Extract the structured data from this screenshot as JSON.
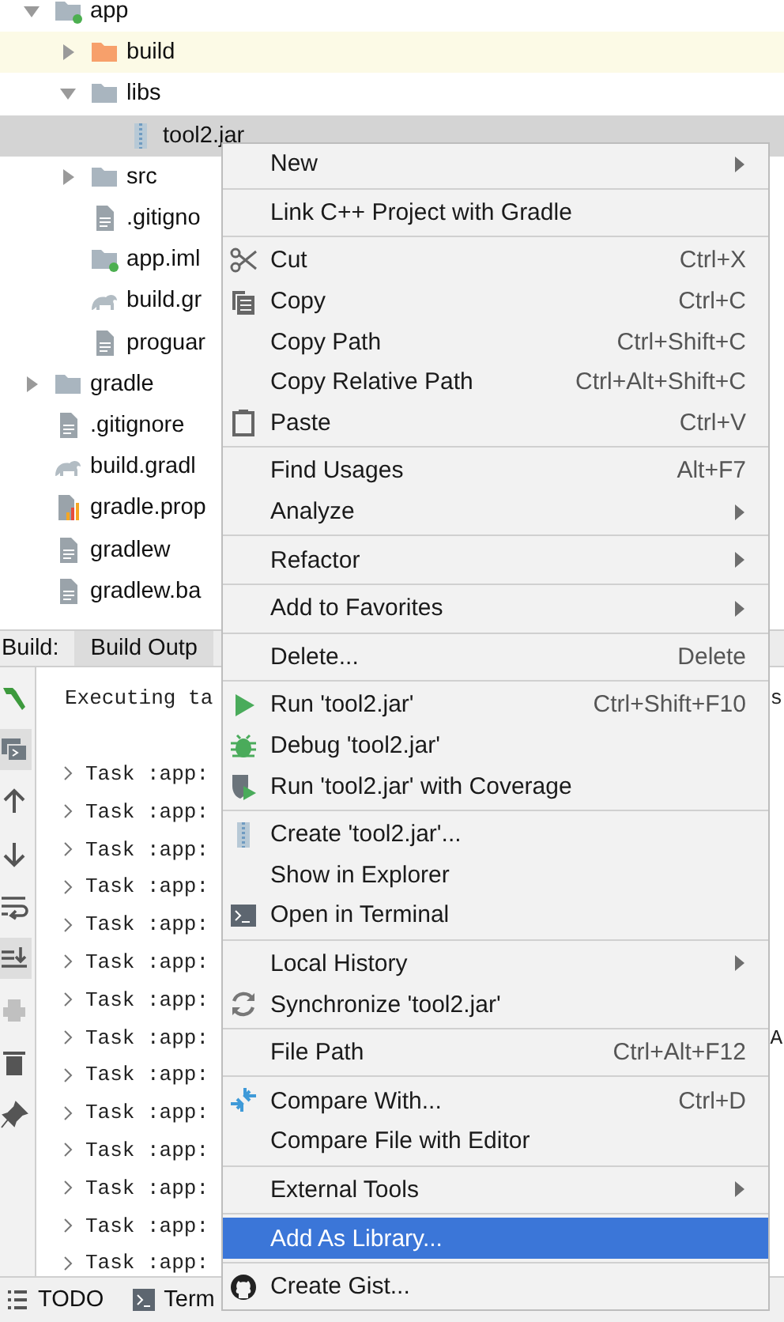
{
  "tree": [
    {
      "label": "app",
      "kind": "module",
      "expanded": true,
      "selected": false,
      "children": [
        {
          "label": "build",
          "kind": "excluded",
          "expanded": false,
          "selected": false
        },
        {
          "label": "libs",
          "kind": "folder",
          "expanded": true,
          "selected": false,
          "children": [
            {
              "label": "tool2.jar",
              "kind": "jar",
              "selected": true
            }
          ]
        },
        {
          "label": "src",
          "kind": "folder",
          "expanded": false,
          "selected": false
        },
        {
          "label": ".gitigno",
          "kind": "text",
          "selected": false
        },
        {
          "label": "app.iml",
          "kind": "module",
          "selected": false
        },
        {
          "label": "build.gr",
          "kind": "gradle",
          "selected": false
        },
        {
          "label": "proguar",
          "kind": "text",
          "selected": false
        }
      ]
    },
    {
      "label": "gradle",
      "kind": "folder",
      "expanded": false,
      "selected": false
    },
    {
      "label": ".gitignore",
      "kind": "text",
      "selected": false
    },
    {
      "label": "build.gradl",
      "kind": "gradle",
      "selected": false
    },
    {
      "label": "gradle.prop",
      "kind": "properties",
      "selected": false
    },
    {
      "label": "gradlew",
      "kind": "text",
      "selected": false
    },
    {
      "label": "gradlew.ba",
      "kind": "text",
      "selected": false
    }
  ],
  "build": {
    "label": "Build:",
    "tabs": [
      {
        "label": "Build Outp",
        "selected": true
      }
    ],
    "toolbar": [
      {
        "selected": false,
        "disabled": false
      },
      {
        "selected": true,
        "disabled": false
      },
      {
        "selected": false,
        "disabled": false
      },
      {
        "selected": false,
        "disabled": false
      },
      {
        "selected": false,
        "disabled": false
      },
      {
        "selected": true,
        "disabled": false
      },
      {
        "selected": false,
        "disabled": true
      },
      {
        "selected": false,
        "disabled": false
      },
      {
        "selected": false,
        "disabled": false
      }
    ],
    "console": [
      {
        "kind": "plain",
        "text": "Executing ta",
        "tail": "s"
      },
      {
        "kind": "task",
        "text": "Task :app:"
      },
      {
        "kind": "task",
        "text": "Task :app:"
      },
      {
        "kind": "task",
        "text": "Task :app:"
      },
      {
        "kind": "task",
        "text": "Task :app:"
      },
      {
        "kind": "task",
        "text": "Task :app:"
      },
      {
        "kind": "task",
        "text": "Task :app:"
      },
      {
        "kind": "task",
        "text": "Task :app:"
      },
      {
        "kind": "task",
        "text": "Task :app:",
        "tail": "A"
      },
      {
        "kind": "task",
        "text": "Task :app:"
      },
      {
        "kind": "task",
        "text": "Task :app:"
      },
      {
        "kind": "task",
        "text": "Task :app:"
      },
      {
        "kind": "task",
        "text": "Task :app:"
      },
      {
        "kind": "task",
        "text": "Task :app:"
      },
      {
        "kind": "task",
        "text": "Task :app:"
      }
    ]
  },
  "bottom_tabs": [
    {
      "label": "TODO"
    },
    {
      "label": "Term"
    }
  ],
  "menu": {
    "groups": [
      [
        {
          "label": "New",
          "submenu": true,
          "selected": false
        }
      ],
      [
        {
          "label": "Link C++ Project with Gradle",
          "submenu": false,
          "selected": false
        }
      ],
      [
        {
          "label": "Cut",
          "shortcut": "Ctrl+X",
          "submenu": false,
          "selected": false
        },
        {
          "label": "Copy",
          "shortcut": "Ctrl+C",
          "submenu": false,
          "selected": false
        },
        {
          "label": "Copy Path",
          "shortcut": "Ctrl+Shift+C",
          "submenu": false,
          "selected": false
        },
        {
          "label": "Copy Relative Path",
          "shortcut": "Ctrl+Alt+Shift+C",
          "submenu": false,
          "selected": false
        },
        {
          "label": "Paste",
          "shortcut": "Ctrl+V",
          "submenu": false,
          "selected": false
        }
      ],
      [
        {
          "label": "Find Usages",
          "shortcut": "Alt+F7",
          "submenu": false,
          "selected": false
        },
        {
          "label": "Analyze",
          "submenu": true,
          "selected": false
        }
      ],
      [
        {
          "label": "Refactor",
          "submenu": true,
          "selected": false
        }
      ],
      [
        {
          "label": "Add to Favorites",
          "submenu": true,
          "selected": false
        }
      ],
      [
        {
          "label": "Delete...",
          "shortcut": "Delete",
          "submenu": false,
          "selected": false
        }
      ],
      [
        {
          "label": "Run 'tool2.jar'",
          "shortcut": "Ctrl+Shift+F10",
          "submenu": false,
          "selected": false
        },
        {
          "label": "Debug 'tool2.jar'",
          "submenu": false,
          "selected": false
        },
        {
          "label": "Run 'tool2.jar' with Coverage",
          "submenu": false,
          "selected": false
        }
      ],
      [
        {
          "label": "Create 'tool2.jar'...",
          "submenu": false,
          "selected": false
        },
        {
          "label": "Show in Explorer",
          "submenu": false,
          "selected": false
        },
        {
          "label": "Open in Terminal",
          "submenu": false,
          "selected": false
        }
      ],
      [
        {
          "label": "Local History",
          "submenu": true,
          "selected": false
        },
        {
          "label": "Synchronize 'tool2.jar'",
          "submenu": false,
          "selected": false
        }
      ],
      [
        {
          "label": "File Path",
          "shortcut": "Ctrl+Alt+F12",
          "submenu": false,
          "selected": false
        }
      ],
      [
        {
          "label": "Compare With...",
          "shortcut": "Ctrl+D",
          "submenu": false,
          "selected": false
        },
        {
          "label": "Compare File with Editor",
          "submenu": false,
          "selected": false
        }
      ],
      [
        {
          "label": "External Tools",
          "submenu": true,
          "selected": false
        }
      ],
      [
        {
          "label": "Add As Library...",
          "submenu": false,
          "selected": true
        }
      ],
      [
        {
          "label": "Create Gist...",
          "submenu": false,
          "selected": false
        }
      ]
    ]
  }
}
